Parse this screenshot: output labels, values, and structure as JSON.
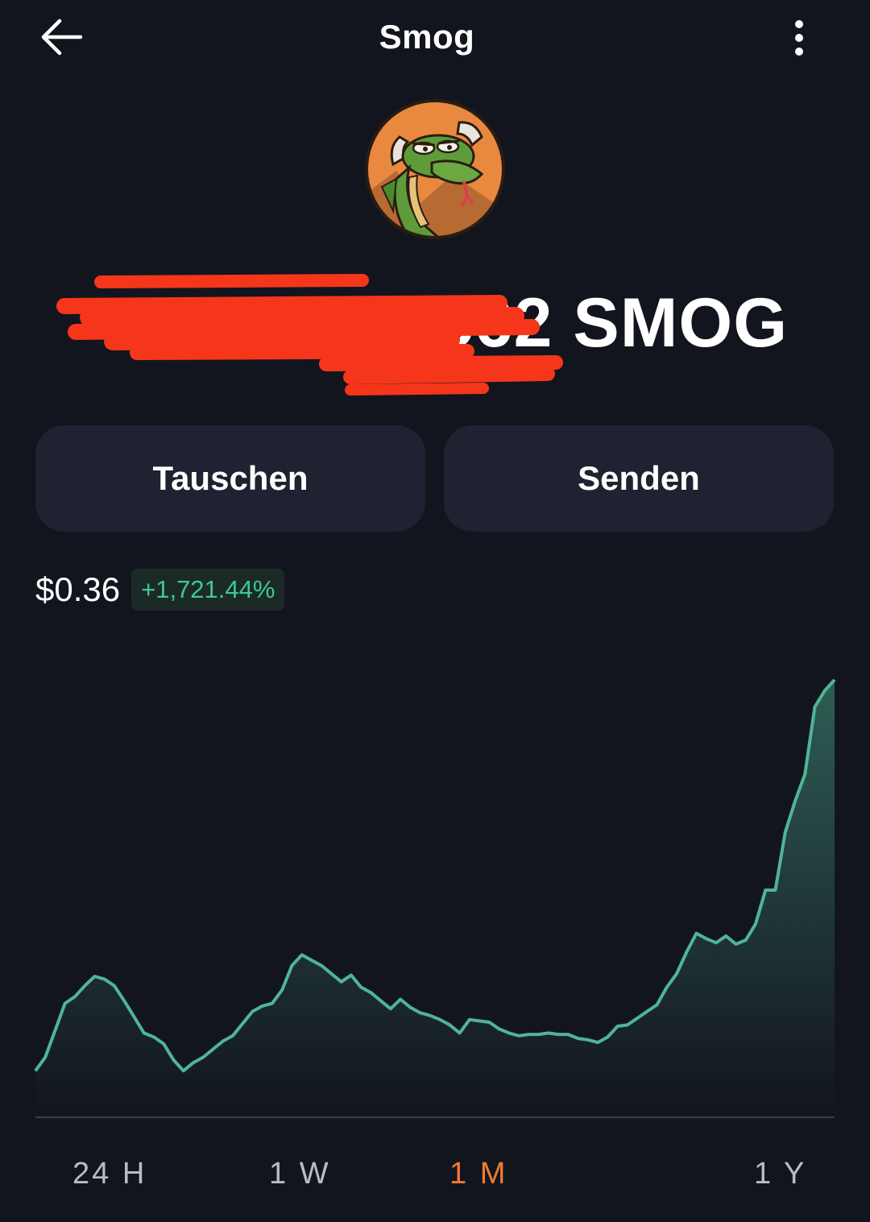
{
  "header": {
    "title": "Smog",
    "back_icon": "arrow-left-icon",
    "more_icon": "more-vertical-icon"
  },
  "token": {
    "avatar_icon": "smog-dragon-avatar",
    "balance_visible": "562 SMOG",
    "balance_redacted": true
  },
  "actions": {
    "swap_label": "Tauschen",
    "send_label": "Senden"
  },
  "price": {
    "value": "$0.36",
    "change": "+1,721.44%",
    "change_color": "#3dc98f"
  },
  "chart_data": {
    "type": "area",
    "line_color": "#4fb595",
    "values": [
      0.07,
      0.08,
      0.1,
      0.12,
      0.125,
      0.133,
      0.14,
      0.138,
      0.133,
      0.122,
      0.11,
      0.098,
      0.095,
      0.09,
      0.078,
      0.07,
      0.076,
      0.08,
      0.086,
      0.092,
      0.096,
      0.105,
      0.114,
      0.118,
      0.12,
      0.13,
      0.148,
      0.156,
      0.152,
      0.148,
      0.142,
      0.136,
      0.141,
      0.132,
      0.128,
      0.122,
      0.116,
      0.123,
      0.117,
      0.113,
      0.111,
      0.108,
      0.104,
      0.098,
      0.108,
      0.107,
      0.106,
      0.101,
      0.098,
      0.096,
      0.097,
      0.097,
      0.098,
      0.097,
      0.097,
      0.094,
      0.093,
      0.091,
      0.095,
      0.103,
      0.104,
      0.109,
      0.114,
      0.119,
      0.132,
      0.142,
      0.158,
      0.172,
      0.168,
      0.165,
      0.17,
      0.164,
      0.167,
      0.179,
      0.204,
      0.204,
      0.247,
      0.27,
      0.29,
      0.34,
      0.352,
      0.36
    ]
  },
  "ranges": {
    "items": [
      "24 H",
      "1 W",
      "1 M",
      "1 Y"
    ],
    "active": "1 M",
    "active_color": "#f07a34"
  }
}
